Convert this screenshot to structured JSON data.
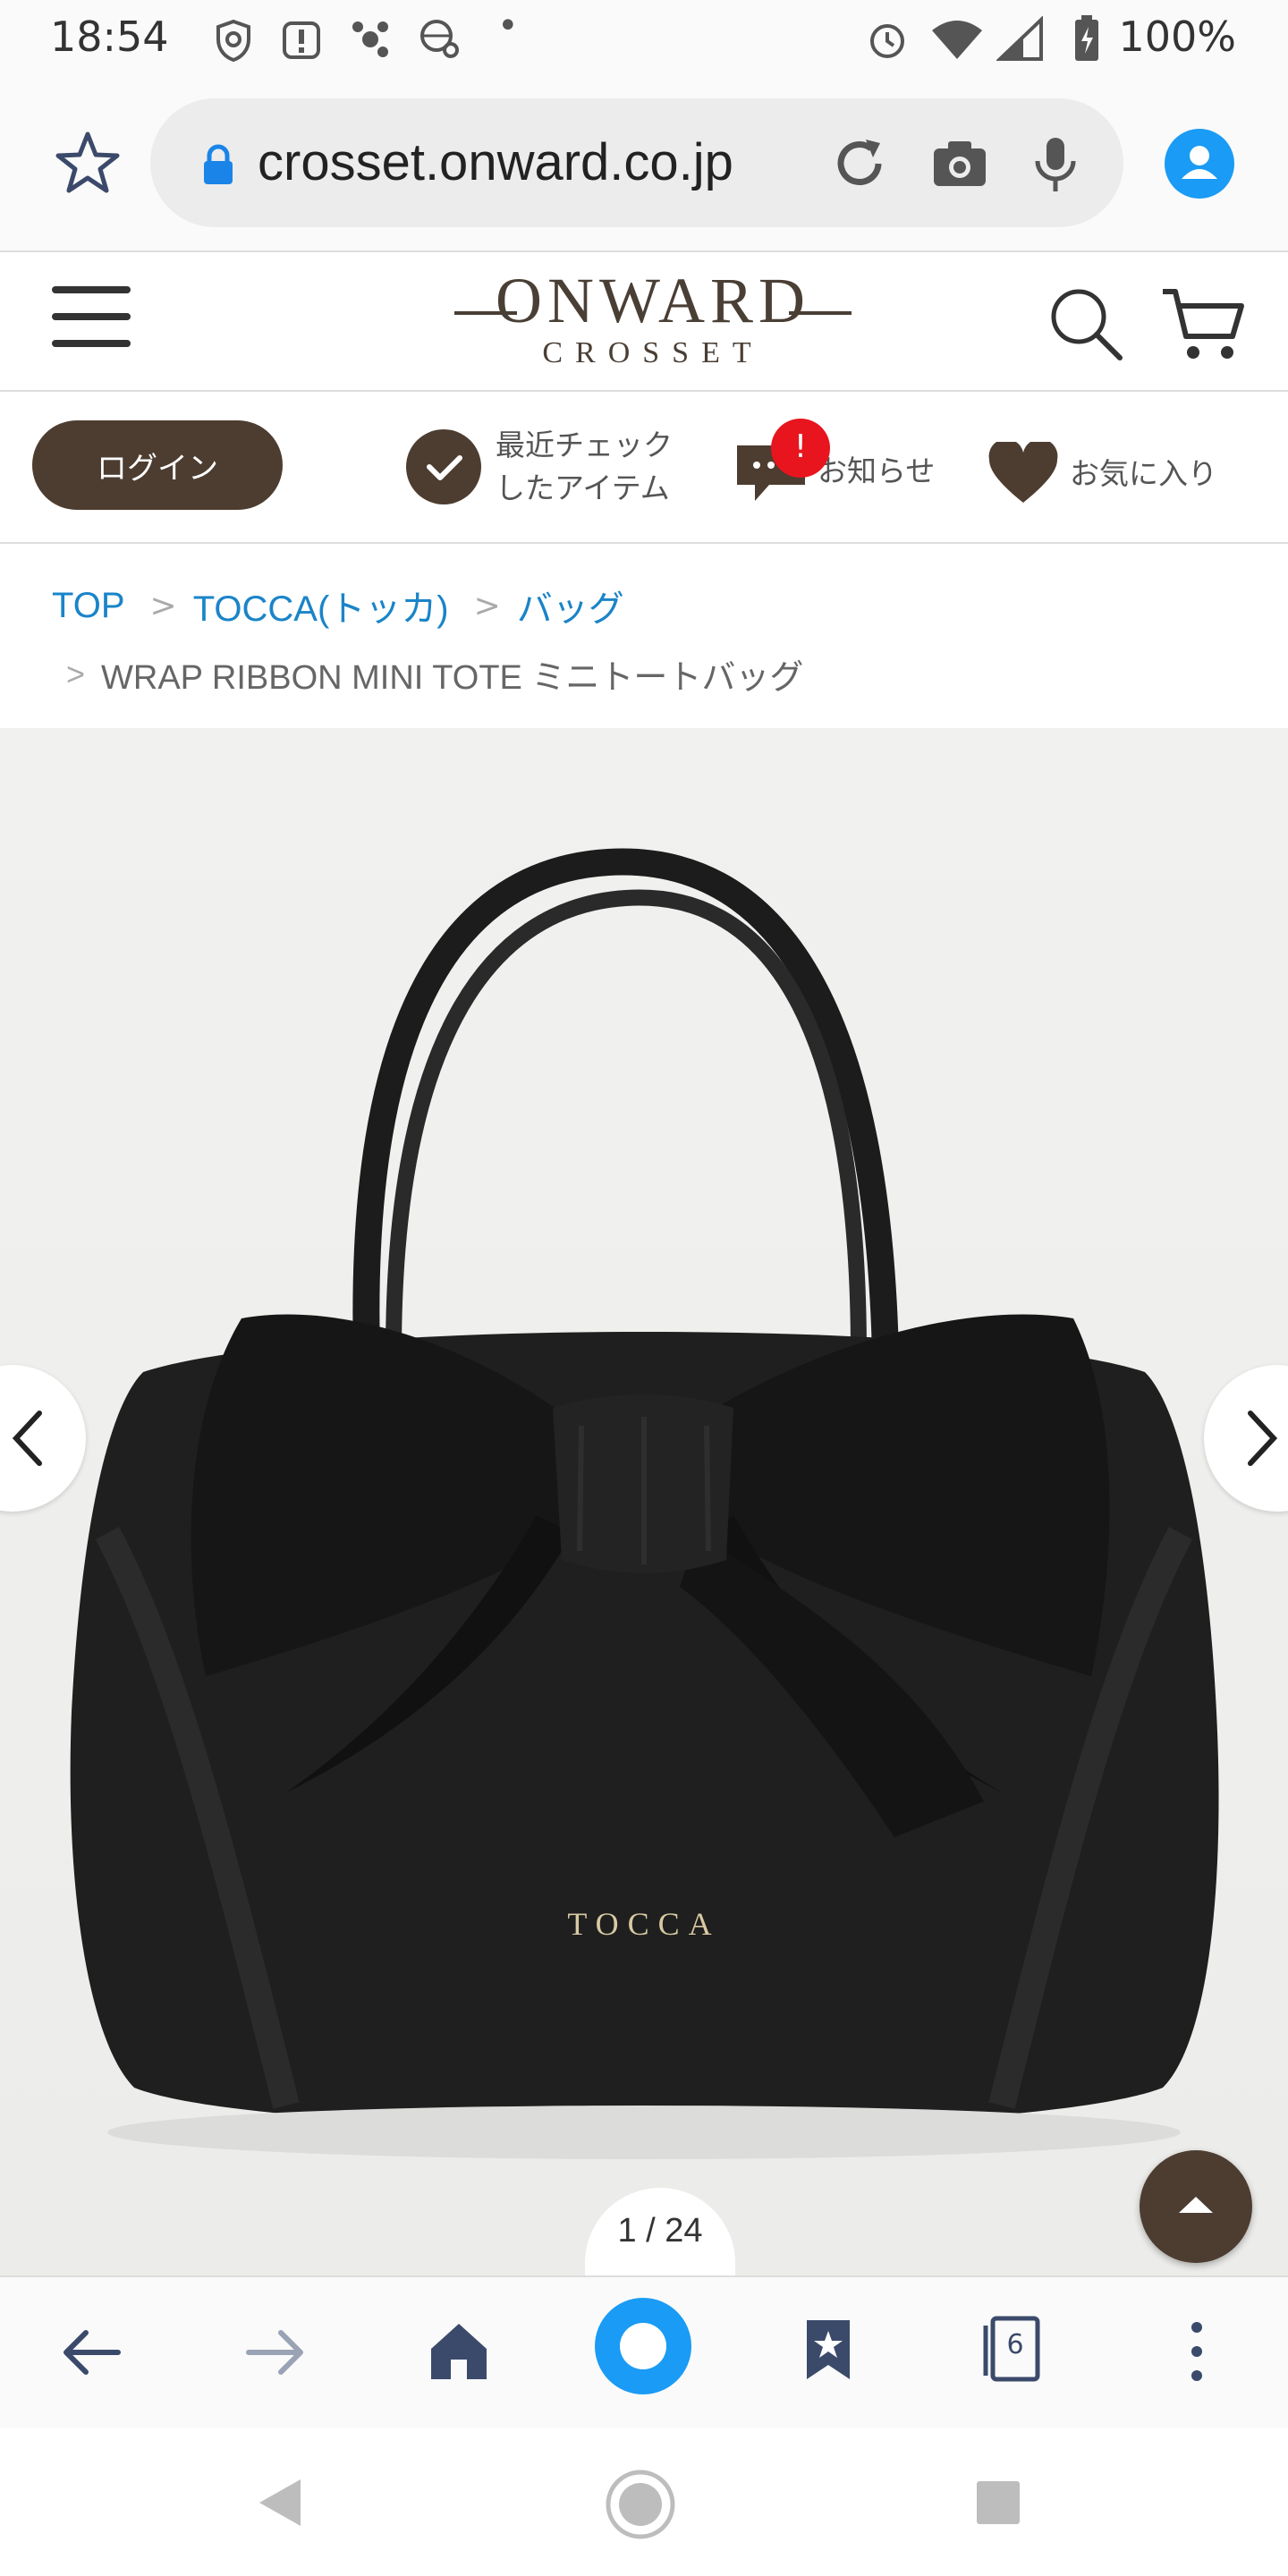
{
  "status_bar": {
    "time": "18:54",
    "dot": "•",
    "battery": "100%"
  },
  "browser": {
    "url": "crosset.onward.co.jp",
    "tab_count": "6"
  },
  "site": {
    "logo_main": "ONWARD",
    "logo_sub": "CROSSET"
  },
  "utility": {
    "login_label": "ログイン",
    "recent_line1": "最近チェック",
    "recent_line2": "したアイテム",
    "notice_label": "お知らせ",
    "notice_badge": "!",
    "favorite_label": "お気に入り"
  },
  "breadcrumb": {
    "items": [
      {
        "label": "TOP"
      },
      {
        "label": "TOCCA(トッカ)"
      },
      {
        "label": "バッグ"
      }
    ],
    "separator": ">",
    "current": "WRAP RIBBON MINI TOTE ミニトートバッグ"
  },
  "product_image": {
    "brand_plate": "TOCCA",
    "counter": "1 / 24"
  },
  "colors": {
    "brand_brown": "#4d3d30",
    "link_blue": "#1a84c8",
    "badge_red": "#e8141e",
    "browser_blue": "#1a9bf5"
  }
}
